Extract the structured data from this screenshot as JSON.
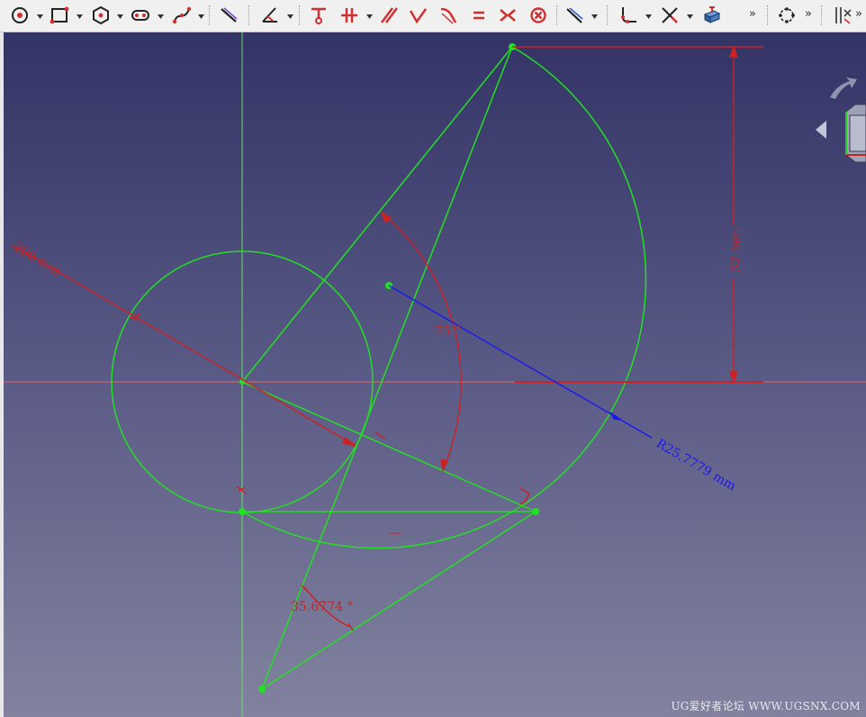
{
  "toolbar": {
    "tools": [
      {
        "name": "create-circle",
        "icon": "circle-icon"
      },
      {
        "name": "create-rectangle",
        "icon": "rectangle-icon"
      },
      {
        "name": "create-polygon",
        "icon": "hexagon-icon"
      },
      {
        "name": "create-slot",
        "icon": "slot-icon"
      },
      {
        "name": "create-bspline",
        "icon": "bspline-icon"
      },
      {
        "name": "external-geometry",
        "icon": "external-geometry-icon"
      },
      {
        "name": "carbon-copy",
        "icon": "carbon-copy-icon"
      },
      {
        "name": "constrain-lock",
        "icon": "lock-constraint-icon"
      },
      {
        "name": "constrain-horizontal-distance",
        "icon": "horizontal-distance-icon"
      },
      {
        "name": "constrain-parallel",
        "icon": "parallel-icon"
      },
      {
        "name": "constrain-perpendicular",
        "icon": "perpendicular-icon"
      },
      {
        "name": "constrain-tangent",
        "icon": "tangent-icon"
      },
      {
        "name": "constrain-equal",
        "icon": "equal-icon"
      },
      {
        "name": "constrain-symmetric",
        "icon": "symmetric-icon"
      },
      {
        "name": "constrain-block",
        "icon": "block-icon"
      },
      {
        "name": "constrain-distance",
        "icon": "distance-icon"
      },
      {
        "name": "fillet",
        "icon": "fillet-icon"
      },
      {
        "name": "trim",
        "icon": "trim-icon"
      },
      {
        "name": "extend",
        "icon": "extend-icon"
      },
      {
        "name": "validate-sketch",
        "icon": "validate-icon"
      },
      {
        "name": "bspline-tools",
        "icon": "bspline-tools-icon"
      }
    ],
    "more_label_1": "»",
    "more_label_2": "»",
    "more_label_3": "»"
  },
  "colors": {
    "sketch_geometry": "#22e022",
    "constraint": "#cc2222",
    "radius_dimension": "#1a1aee",
    "axis_horizontal": "#e06666",
    "axis_vertical": "#66e066",
    "viewport_top": "#333366",
    "viewport_bottom": "#82829f"
  },
  "dimensions": {
    "diameter_label": "200 mm",
    "angle_label": "75 °",
    "vertical_label": "32 mm",
    "radius_label": "R25.7779 mm",
    "angle2_label": "35.6774 °",
    "horizontal_marker": "—"
  },
  "watermark": "UG爱好者论坛 WWW.UGSNX.COM"
}
